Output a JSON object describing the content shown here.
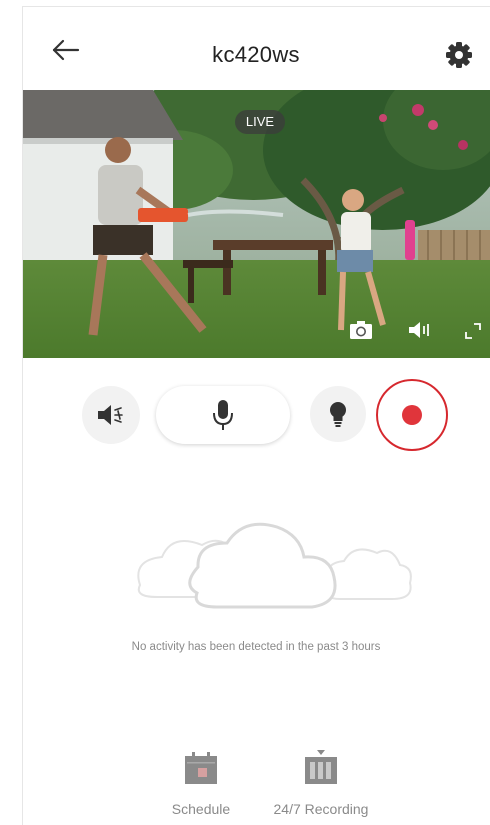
{
  "header": {
    "title": "kc420ws",
    "back_icon": "back-arrow-icon",
    "settings_icon": "gear-icon"
  },
  "video": {
    "live_label": "LIVE",
    "controls": [
      "camera-snapshot-icon",
      "speaker-volume-icon",
      "fullscreen-icon"
    ]
  },
  "controls": {
    "buttons": [
      "speaker-mute-icon",
      "microphone-icon",
      "light-bulb-icon",
      "record-icon"
    ],
    "record_color": "#e0353b"
  },
  "activity": {
    "empty_message": "No activity has been detected in the past 3 hours",
    "illustration": "cloud-icon"
  },
  "tabs": [
    {
      "label": "Schedule",
      "icon": "calendar-icon"
    },
    {
      "label": "24/7 Recording",
      "icon": "recording-icon"
    }
  ]
}
